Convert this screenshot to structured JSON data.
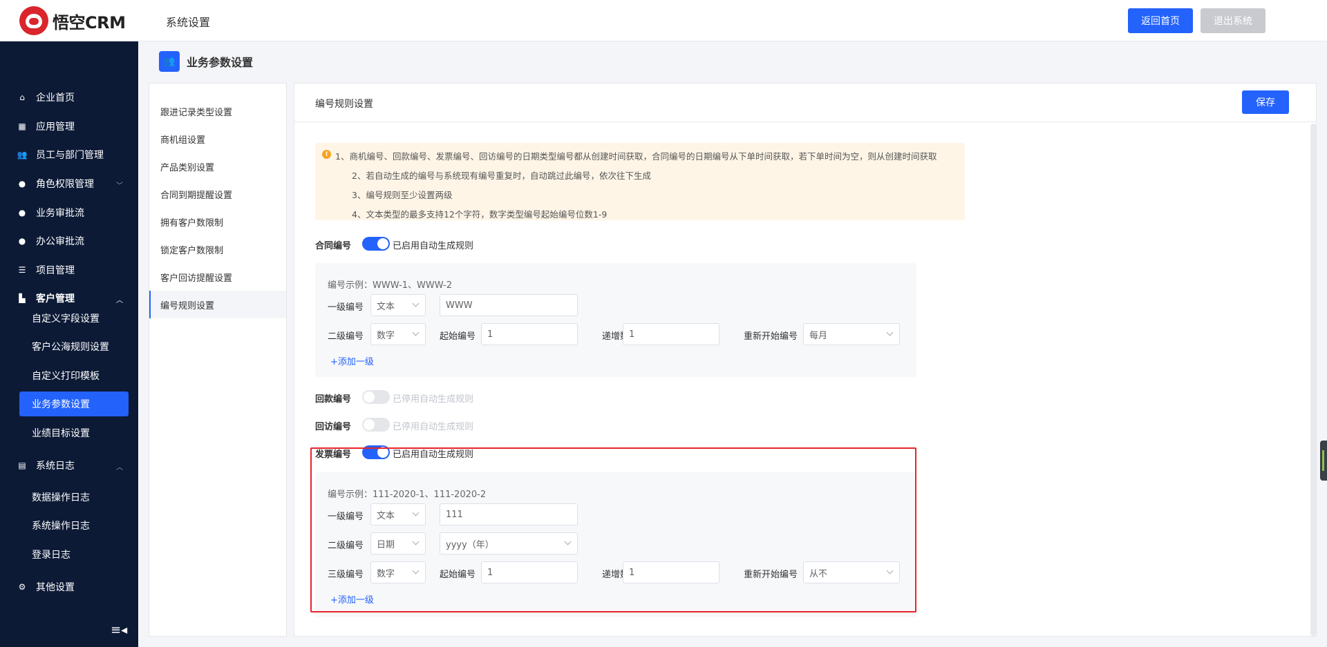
{
  "app": {
    "logo_text": "悟空CRM",
    "section_title": "系统设置",
    "home_button": "返回首页",
    "exit_button": "退出系统"
  },
  "sidebar": {
    "items": [
      {
        "label": "企业首页",
        "icon": "home-icon"
      },
      {
        "label": "应用管理",
        "icon": "grid-icon"
      },
      {
        "label": "员工与部门管理",
        "icon": "users-icon"
      },
      {
        "label": "角色权限管理",
        "icon": "user-icon"
      },
      {
        "label": "业务审批流",
        "icon": "user-icon"
      },
      {
        "label": "办公审批流",
        "icon": "user-icon"
      },
      {
        "label": "项目管理",
        "icon": "list-icon"
      },
      {
        "label": "客户管理",
        "icon": "building-icon"
      },
      {
        "label": "系统日志",
        "icon": "log-icon"
      },
      {
        "label": "其他设置",
        "icon": "gear-icon"
      }
    ],
    "customer_sub": [
      "自定义字段设置",
      "客户公海规则设置",
      "自定义打印模板",
      "业务参数设置",
      "业绩目标设置"
    ],
    "log_sub": [
      "数据操作日志",
      "系统操作日志",
      "登录日志"
    ]
  },
  "page": {
    "title": "业务参数设置"
  },
  "left_menu": [
    "跟进记录类型设置",
    "商机组设置",
    "产品类别设置",
    "合同到期提醒设置",
    "拥有客户数限制",
    "锁定客户数限制",
    "客户回访提醒设置",
    "编号规则设置"
  ],
  "main": {
    "title": "编号规则设置",
    "save_button": "保存",
    "notice": [
      "1、商机编号、回款编号、发票编号、回访编号的日期类型编号都从创建时间获取，合同编号的日期编号从下单时间获取，若下单时间为空，则从创建时间获取",
      "2、若自动生成的编号与系统现有编号重复时，自动跳过此编号，依次往下生成",
      "3、编号规则至少设置两级",
      "4、文本类型的最多支持12个字符，数字类型编号起始编号位数1-9"
    ],
    "contract": {
      "label": "合同编号",
      "switch_text": "已启用自动生成规则",
      "example": "编号示例：WWW-1、WWW-2",
      "level1_label": "一级编号",
      "level1_type": "文本",
      "level1_value": "WWW",
      "level2_label": "二级编号",
      "level2_type": "数字",
      "start_label": "起始编号",
      "start_value": "1",
      "step_label": "递增数",
      "step_value": "1",
      "restart_label": "重新开始编号",
      "restart_value": "每月",
      "add_level": "+添加一级"
    },
    "payment": {
      "label": "回款编号",
      "switch_text": "已停用自动生成规则"
    },
    "visit": {
      "label": "回访编号",
      "switch_text": "已停用自动生成规则"
    },
    "invoice": {
      "label": "发票编号",
      "switch_text": "已启用自动生成规则",
      "example": "编号示例：111-2020-1、111-2020-2",
      "level1_label": "一级编号",
      "level1_type": "文本",
      "level1_value": "111",
      "level2_label": "二级编号",
      "level2_type": "日期",
      "level2_value": "yyyy（年）",
      "level3_label": "三级编号",
      "level3_type": "数字",
      "start_label": "起始编号",
      "start_value": "1",
      "step_label": "递增数",
      "step_value": "1",
      "restart_label": "重新开始编号",
      "restart_value": "从不",
      "add_level": "+添加一级"
    }
  },
  "colors": {
    "accent": "#2362fb",
    "sidebar_bg": "#0c1a36",
    "highlight": "#e9222a",
    "notice_bg": "#fef5e7"
  }
}
